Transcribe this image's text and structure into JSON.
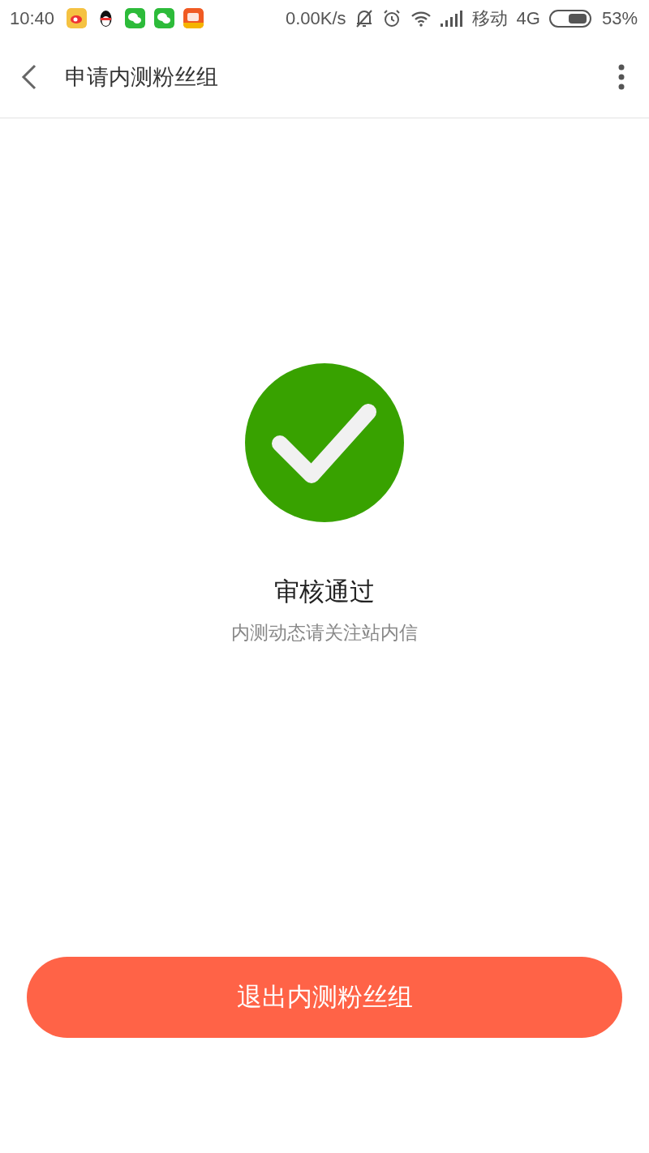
{
  "status_bar": {
    "time": "10:40",
    "speed": "0.00K/s",
    "carrier": "移动",
    "network": "4G",
    "battery": "53%"
  },
  "header": {
    "title": "申请内测粉丝组"
  },
  "result": {
    "title": "审核通过",
    "subtitle": "内测动态请关注站内信"
  },
  "button": {
    "label": "退出内测粉丝组"
  }
}
